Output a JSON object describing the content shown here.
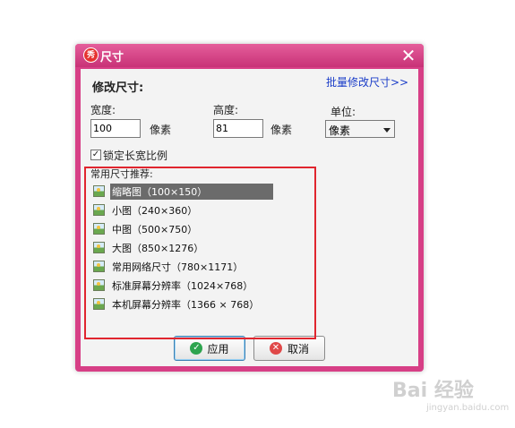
{
  "dialog": {
    "title": "尺寸",
    "app_icon_char": "秀",
    "close_glyph": "✕"
  },
  "header": {
    "title": "修改尺寸:",
    "batch_link": "批量修改尺寸>>"
  },
  "size": {
    "width_label": "宽度:",
    "width_value": "100",
    "width_unit": "像素",
    "height_label": "高度:",
    "height_value": "81",
    "height_unit": "像素",
    "unit_label": "单位:",
    "unit_selected": "像素"
  },
  "lock_ratio": {
    "checked": true,
    "label": "锁定长宽比例"
  },
  "presets": {
    "label": "常用尺寸推荐:",
    "items": [
      {
        "text": "缩略图（100×150）",
        "selected": true
      },
      {
        "text": "小图（240×360）",
        "selected": false
      },
      {
        "text": "中图（500×750）",
        "selected": false
      },
      {
        "text": "大图（850×1276）",
        "selected": false
      },
      {
        "text": "常用网络尺寸（780×1171）",
        "selected": false
      },
      {
        "text": "标准屏幕分辨率（1024×768）",
        "selected": false
      },
      {
        "text": "本机屏幕分辨率（1366 × 768）",
        "selected": false
      }
    ]
  },
  "buttons": {
    "ok_label": "应用",
    "cancel_label": "取消"
  },
  "watermark": {
    "brand": "Bai 经验",
    "url": "jingyan.baidu.com"
  },
  "colors": {
    "titlebar": "#d73f86",
    "highlight_box": "#e0252e",
    "link": "#1a3cc8"
  }
}
